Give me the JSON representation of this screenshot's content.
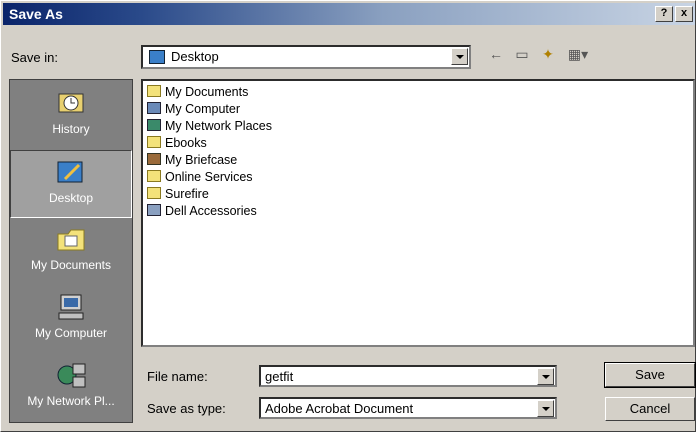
{
  "window": {
    "title": "Save As"
  },
  "titlebar": {
    "help": "?",
    "close": "x"
  },
  "save_in": {
    "label": "Save in:",
    "value": "Desktop"
  },
  "toolbar": {
    "back": "←",
    "up": "▭",
    "new_folder": "✦",
    "views": "▦▾"
  },
  "places": [
    {
      "label": "History",
      "icon": "history-icon"
    },
    {
      "label": "Desktop",
      "icon": "desktop-icon"
    },
    {
      "label": "My Documents",
      "icon": "my-documents-icon"
    },
    {
      "label": "My Computer",
      "icon": "my-computer-icon"
    },
    {
      "label": "My Network Pl...",
      "icon": "network-places-icon"
    }
  ],
  "files": [
    {
      "name": "My Documents",
      "icon": "my-documents-icon"
    },
    {
      "name": "My Computer",
      "icon": "my-computer-icon"
    },
    {
      "name": "My Network Places",
      "icon": "network-places-icon"
    },
    {
      "name": "Ebooks",
      "icon": "folder-icon"
    },
    {
      "name": "My Briefcase",
      "icon": "briefcase-icon"
    },
    {
      "name": "Online Services",
      "icon": "folder-icon"
    },
    {
      "name": "Surefire",
      "icon": "folder-icon"
    },
    {
      "name": "Dell Accessories",
      "icon": "program-group-icon"
    }
  ],
  "file_name": {
    "label": "File name:",
    "value": "getfit"
  },
  "save_as_type": {
    "label": "Save as type:",
    "value": "Adobe Acrobat Document"
  },
  "buttons": {
    "save": "Save",
    "cancel": "Cancel"
  }
}
